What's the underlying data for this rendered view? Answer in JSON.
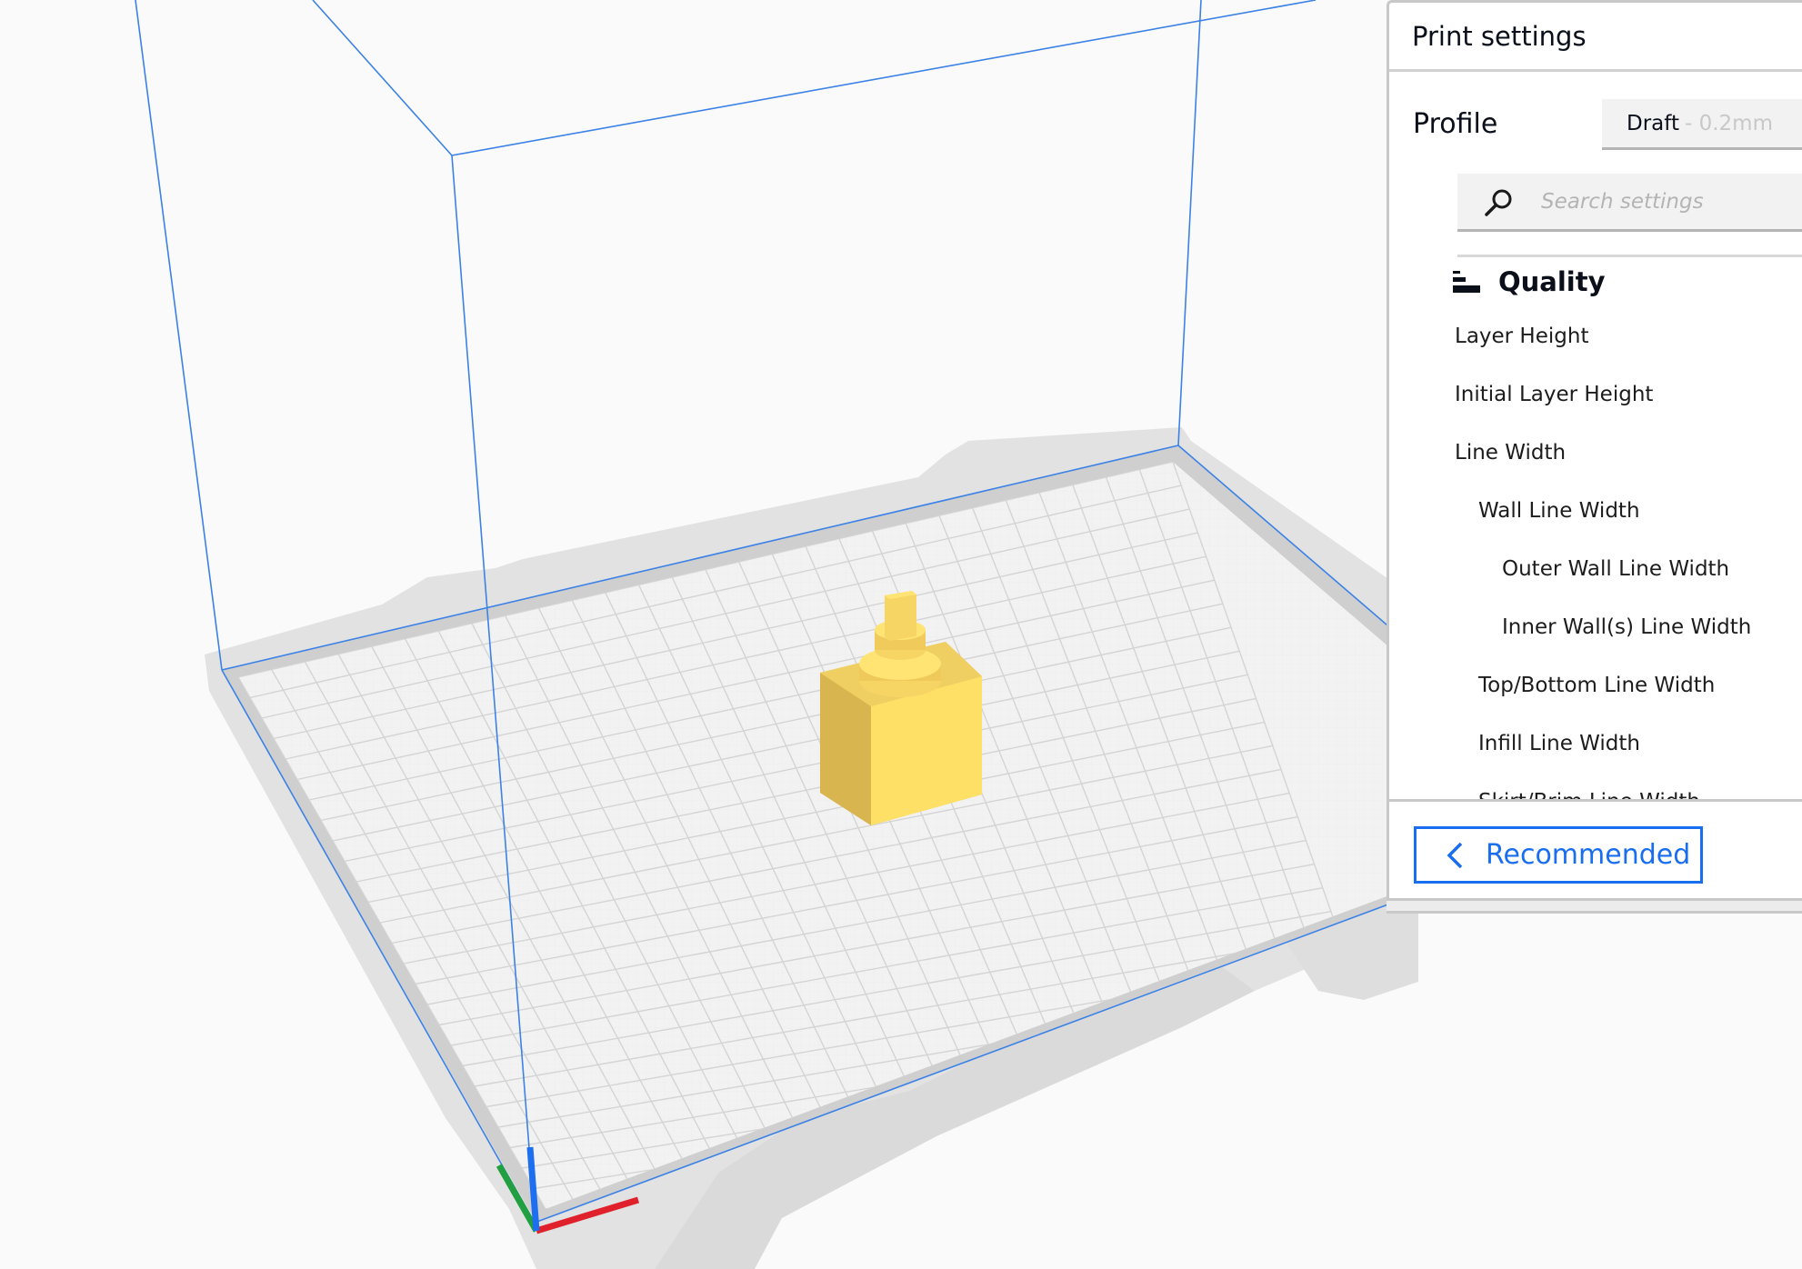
{
  "viewport": {
    "model_color": "#f7d565",
    "build_volume_color": "#3c82e6",
    "axis_colors": {
      "x": "#e0202a",
      "y": "#20a040",
      "z": "#1e6ef0"
    }
  },
  "print_settings": {
    "title": "Print settings",
    "profile": {
      "label": "Profile",
      "name": "Draft",
      "detail": "- 0.2mm"
    },
    "search": {
      "placeholder": "Search settings",
      "value": ""
    },
    "category": {
      "icon": "quality-icon",
      "label": "Quality"
    },
    "settings": [
      {
        "label": "Layer Height",
        "level": 0
      },
      {
        "label": "Initial Layer Height",
        "level": 0
      },
      {
        "label": "Line Width",
        "level": 0
      },
      {
        "label": "Wall Line Width",
        "level": 1
      },
      {
        "label": "Outer Wall Line Width",
        "level": 2
      },
      {
        "label": "Inner Wall(s) Line Width",
        "level": 2
      },
      {
        "label": "Top/Bottom Line Width",
        "level": 1
      },
      {
        "label": "Infill Line Width",
        "level": 1
      },
      {
        "label": "Skirt/Brim Line Width",
        "level": 1
      }
    ],
    "recommended_button": {
      "icon": "chevron-left-icon",
      "label": "Recommended"
    },
    "accent_color": "#196ef0"
  }
}
